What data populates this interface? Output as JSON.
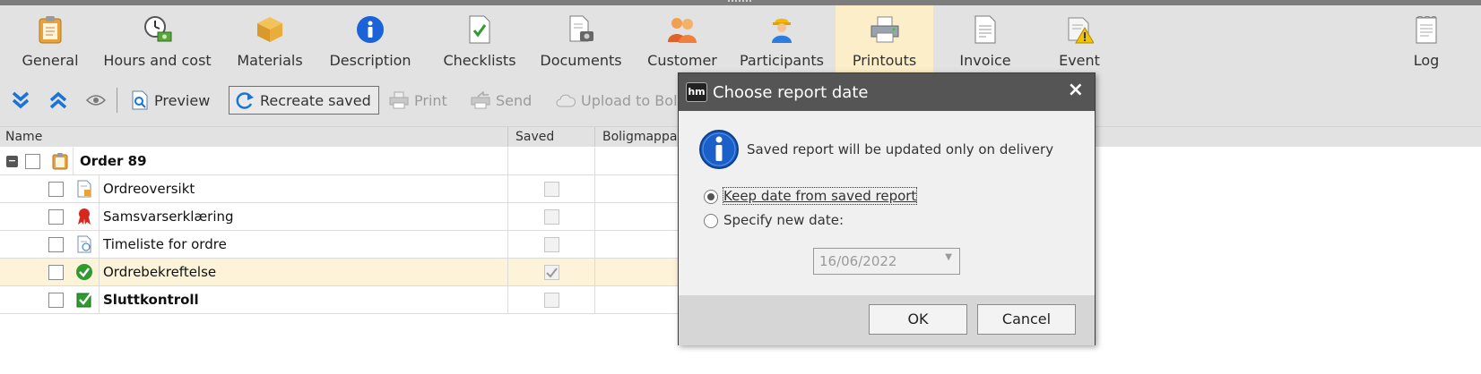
{
  "ribbon": {
    "tabs": [
      {
        "label": "General",
        "icon": "clipboard-icon"
      },
      {
        "label": "Hours and cost",
        "icon": "clock-money-icon"
      },
      {
        "label": "Materials",
        "icon": "box-icon"
      },
      {
        "label": "Description",
        "icon": "info-icon"
      },
      {
        "label": "Checklists",
        "icon": "checklist-icon"
      },
      {
        "label": "Documents",
        "icon": "documents-icon"
      },
      {
        "label": "Customer",
        "icon": "customer-icon"
      },
      {
        "label": "Participants",
        "icon": "worker-icon"
      },
      {
        "label": "Printouts",
        "icon": "printer-icon"
      },
      {
        "label": "Invoice",
        "icon": "invoice-icon"
      },
      {
        "label": "Event",
        "icon": "event-warning-icon"
      },
      {
        "label": "Log",
        "icon": "log-icon"
      }
    ],
    "active_tab": "Printouts"
  },
  "toolbar": {
    "preview": "Preview",
    "recreate_saved": "Recreate saved",
    "print": "Print",
    "send": "Send",
    "upload": "Upload to Bolig"
  },
  "columns": {
    "name": "Name",
    "saved": "Saved",
    "boligmappa": "Boligmappa"
  },
  "tree": {
    "root": {
      "label": "Order 89"
    },
    "items": [
      {
        "label": "Ordreoversikt",
        "saved": false,
        "bold": false
      },
      {
        "label": "Samsvarserklæring",
        "saved": false,
        "bold": false
      },
      {
        "label": "Timeliste for ordre",
        "saved": false,
        "bold": false
      },
      {
        "label": "Ordrebekreftelse",
        "saved": true,
        "bold": false,
        "selected": true
      },
      {
        "label": "Sluttkontroll",
        "saved": false,
        "bold": true
      }
    ]
  },
  "dialog": {
    "logo": "hm",
    "title": "Choose report date",
    "close": "×",
    "message": "Saved report will be updated only on delivery",
    "option_keep": "Keep date from saved report",
    "option_specify": "Specify new date:",
    "selected_option": "keep",
    "date_value": "16/06/2022",
    "ok_label": "OK",
    "cancel_label": "Cancel"
  },
  "colors": {
    "ribbon_bg": "#e2e2e2",
    "active_tab_bg": "#fbeec8",
    "selected_row_bg": "#fdf3d9",
    "dialog_title_bg": "#555555",
    "dialog_footer_bg": "#d6d6d6"
  }
}
